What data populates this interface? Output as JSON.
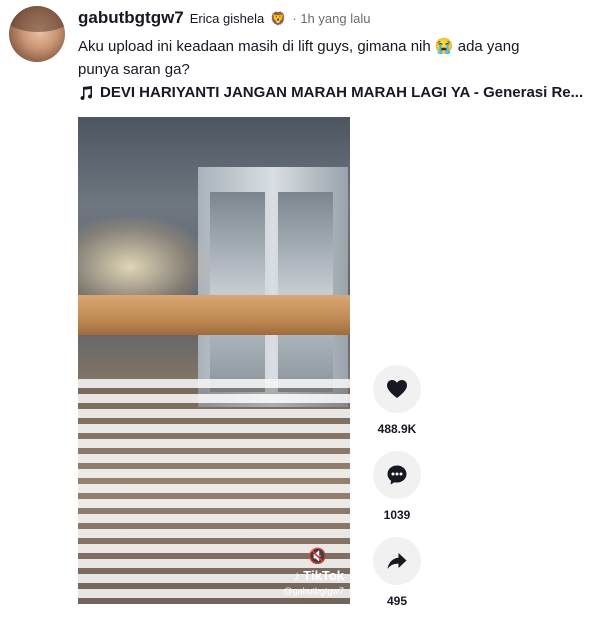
{
  "post": {
    "username": "gabutbgtgw7",
    "nickname": "Erica gishela",
    "badge_emoji": "🦁",
    "time_ago": "· 1h yang lalu",
    "caption": "Aku upload ini keadaan masih di lift guys, gimana nih 😭 ada yang punya saran ga?",
    "music": "DEVI HARIYANTI JANGAN MARAH MARAH LAGI YA - Generasi Re..."
  },
  "video": {
    "watermark_brand": "TikTok",
    "watermark_user": "@gabutbgtgw7"
  },
  "actions": {
    "likes": "488.9K",
    "comments": "1039",
    "shares": "495"
  }
}
